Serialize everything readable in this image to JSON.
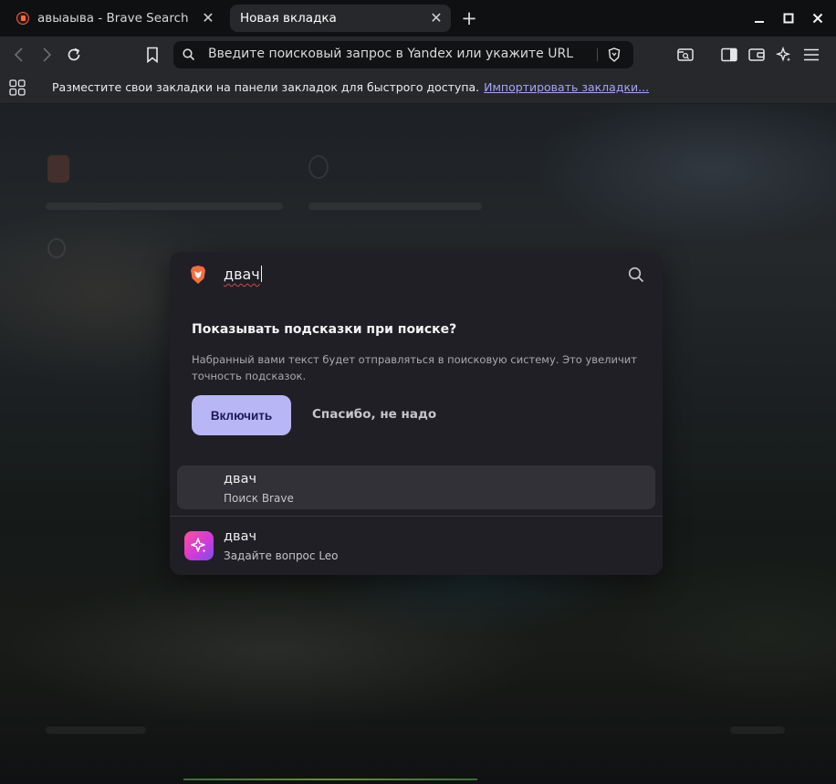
{
  "tabs": [
    {
      "title": "авыаыва - Brave Search",
      "favicon": "brave-search-favicon",
      "active": false
    },
    {
      "title": "Новая вкладка",
      "active": true
    }
  ],
  "toolbar": {
    "address_placeholder": "Введите поисковый запрос в Yandex или укажите URL"
  },
  "bookmarks_bar": {
    "hint": "Разместите свои закладки на панели закладок для быстрого доступа.",
    "import_link": "Импортировать закладки..."
  },
  "popup": {
    "query": "двач",
    "heading": "Показывать подсказки при поиске?",
    "description": "Набранный вами текст будет отправляться в поисковую систему. Это увеличит точность подсказок.",
    "enable_label": "Включить",
    "decline_label": "Спасибо, не надо",
    "suggestions": [
      {
        "title": "двач",
        "subtitle": "Поиск Brave",
        "icon": "none",
        "selected": true
      },
      {
        "title": "двач",
        "subtitle": "Задайте вопрос Leo",
        "icon": "leo-sparkle-icon",
        "selected": false
      }
    ]
  },
  "colors": {
    "accent_button": "#b9b6f6",
    "link": "#a7a4f5",
    "brave_orange": "#f36e3f"
  }
}
